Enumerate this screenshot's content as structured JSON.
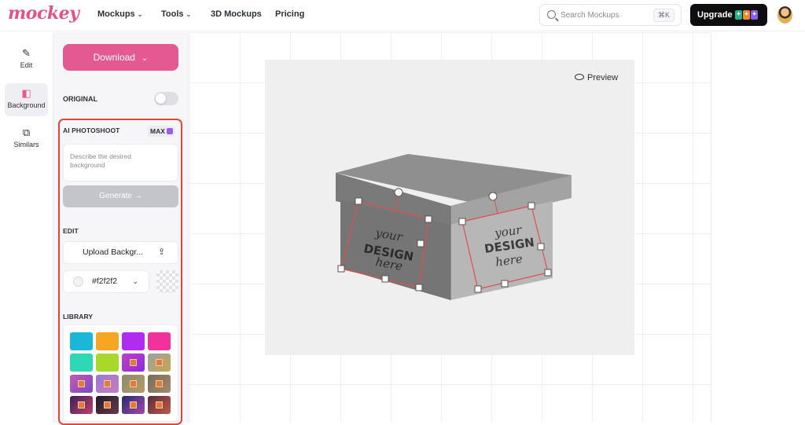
{
  "header": {
    "logo": "mockey",
    "nav": [
      {
        "label": "Mockups",
        "has_dropdown": true
      },
      {
        "label": "Tools",
        "has_dropdown": true
      },
      {
        "label": "3D Mockups",
        "has_dropdown": false
      },
      {
        "label": "Pricing",
        "has_dropdown": false
      }
    ],
    "search": {
      "placeholder": "Search Mockups",
      "shortcut": "⌘K"
    },
    "upgrade_label": "Upgrade"
  },
  "rail": {
    "items": [
      {
        "label": "Edit",
        "icon": "pencil-icon"
      },
      {
        "label": "Background",
        "icon": "background-icon",
        "active": true
      },
      {
        "label": "Similars",
        "icon": "similars-icon"
      }
    ]
  },
  "panel": {
    "download_label": "Download",
    "original_label": "ORIGINAL",
    "original_toggle": false,
    "ai_photoshoot": {
      "title": "AI PHOTOSHOOT",
      "badge": "MAX",
      "placeholder": "Describe the desired background",
      "generate_label": "Generate →"
    },
    "edit": {
      "title": "EDIT",
      "upload_label": "Upload Backgr...",
      "color_value": "#f2f2f2"
    },
    "library": {
      "title": "LIBRARY"
    }
  },
  "canvas": {
    "preview_label": "Preview",
    "design_text": [
      "your",
      "DESIGN",
      "here"
    ]
  },
  "colors": {
    "accent": "#e45991",
    "highlight": "#e2453b",
    "selection": "#e24d4d"
  }
}
